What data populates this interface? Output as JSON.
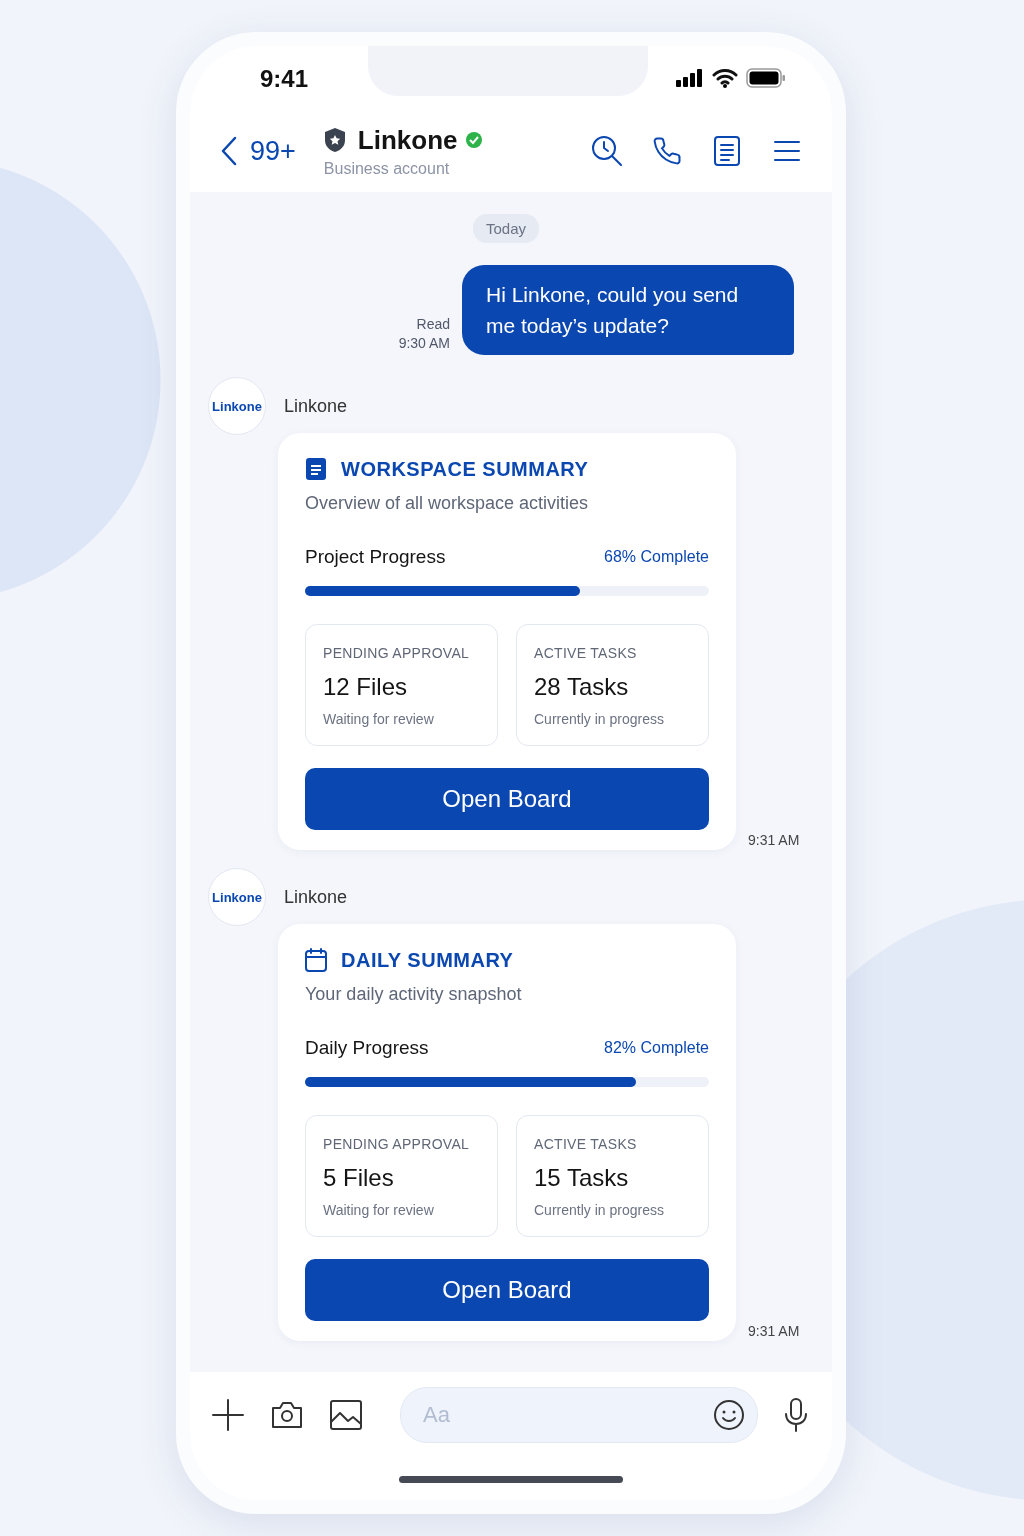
{
  "status_bar": {
    "time": "9:41"
  },
  "header": {
    "back_count": "99+",
    "name": "Linkone",
    "subtitle": "Business account"
  },
  "date_label": "Today",
  "messages": [
    {
      "kind": "outgoing",
      "text": "Hi Linkone, could you send me today’s update?",
      "status": "Read",
      "time": "9:30 AM"
    },
    {
      "kind": "card",
      "sender": "Linkone",
      "avatar": "Linkone",
      "title": "WORKSPACE SUMMARY",
      "subtitle": "Overview of all workspace activities",
      "progress_label": "Project Progress",
      "progress_text": "68% Complete",
      "level": 0.68,
      "stats": [
        {
          "label": "PENDING APPROVAL",
          "value": "12 Files",
          "note": "Waiting for review"
        },
        {
          "label": "ACTIVE TASKS",
          "value": "28 Tasks",
          "note": "Currently in progress"
        }
      ],
      "button": "Open Board",
      "time": "9:31 AM"
    },
    {
      "kind": "card",
      "sender": "Linkone",
      "avatar": "Linkone",
      "title": "DAILY SUMMARY",
      "subtitle": "Your daily activity snapshot",
      "progress_label": "Daily Progress",
      "progress_text": "82% Complete",
      "level": 0.82,
      "stats": [
        {
          "label": "PENDING APPROVAL",
          "value": "5 Files",
          "note": "Waiting for review"
        },
        {
          "label": "ACTIVE TASKS",
          "value": "15 Tasks",
          "note": "Currently in progress"
        }
      ],
      "button": "Open Board",
      "time": "9:31 AM"
    }
  ],
  "composer": {
    "placeholder": "Aa"
  }
}
